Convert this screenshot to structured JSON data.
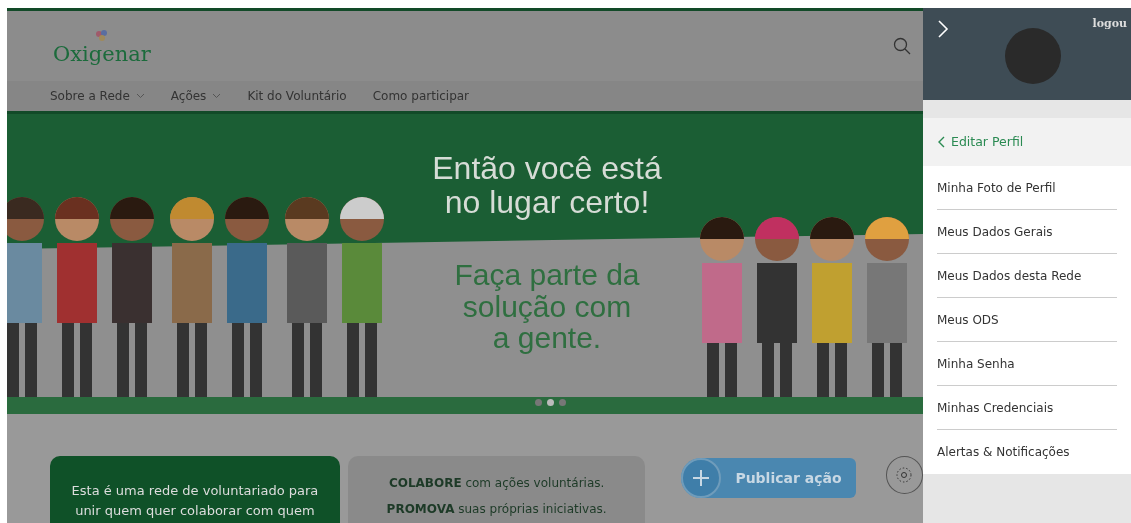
{
  "site": {
    "logo": "Oxigenar",
    "nav": [
      {
        "label": "Sobre a Rede",
        "dropdown": true
      },
      {
        "label": "Ações",
        "dropdown": true
      },
      {
        "label": "Kit do Voluntário",
        "dropdown": false
      },
      {
        "label": "Como participar",
        "dropdown": false
      }
    ]
  },
  "banner": {
    "headline": [
      "Então você está",
      "no lugar certo!"
    ],
    "subline": [
      "Faça parte da",
      "solução com",
      "a gente."
    ],
    "dots": [
      {
        "selected": false
      },
      {
        "selected": true
      },
      {
        "selected": false
      }
    ]
  },
  "intro": {
    "text": "Esta é uma rede de voluntariado para unir quem quer colaborar com quem",
    "lines": [
      "**COLABORE** com ações voluntárias.",
      "**PROMOVA** suas próprias iniciativas."
    ],
    "publish": "Publicar ação"
  },
  "panel": {
    "logout": "logou",
    "back": "Editar Perfil",
    "items": [
      "Minha Foto de Perfil",
      "Meus Dados Gerais",
      "Meus Dados desta Rede",
      "Meus ODS",
      "Minha Senha",
      "Minhas Credenciais",
      "Alertas & Notificações"
    ]
  }
}
